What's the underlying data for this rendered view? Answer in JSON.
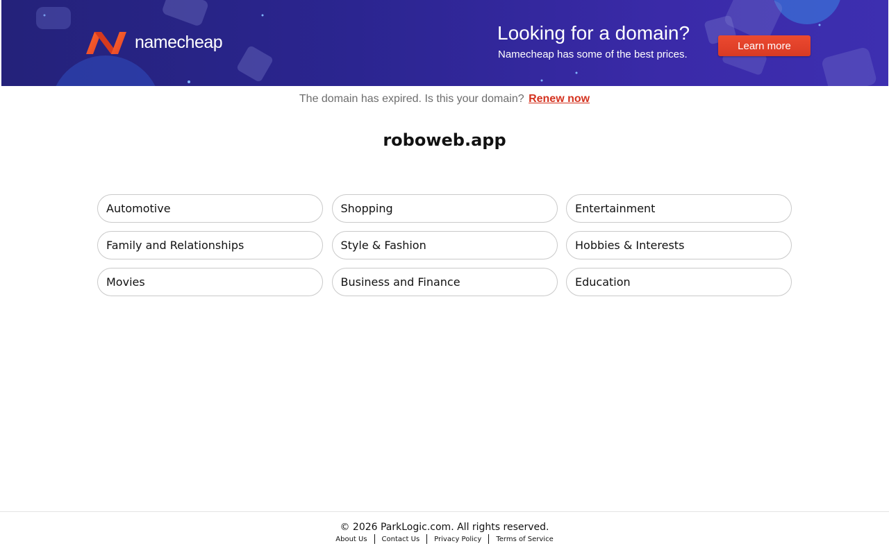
{
  "banner": {
    "brand": "namecheap",
    "promo_title": "Looking for a domain?",
    "promo_subtitle": "Namecheap has some of the best prices.",
    "cta_label": "Learn more",
    "colors": {
      "background": "#2b2590",
      "cta": "#e2402a",
      "logo": "#f05a28"
    }
  },
  "notice": {
    "text": "The domain has expired. Is this your domain?",
    "link_label": "Renew now"
  },
  "domain_name": "roboweb.app",
  "categories": [
    "Automotive",
    "Shopping",
    "Entertainment",
    "Family and Relationships",
    "Style & Fashion",
    "Hobbies & Interests",
    "Movies",
    "Business and Finance",
    "Education"
  ],
  "footer": {
    "copyright": "© 2026 ParkLogic.com. All rights reserved.",
    "links": [
      "About Us",
      "Contact Us",
      "Privacy Policy",
      "Terms of Service"
    ]
  }
}
